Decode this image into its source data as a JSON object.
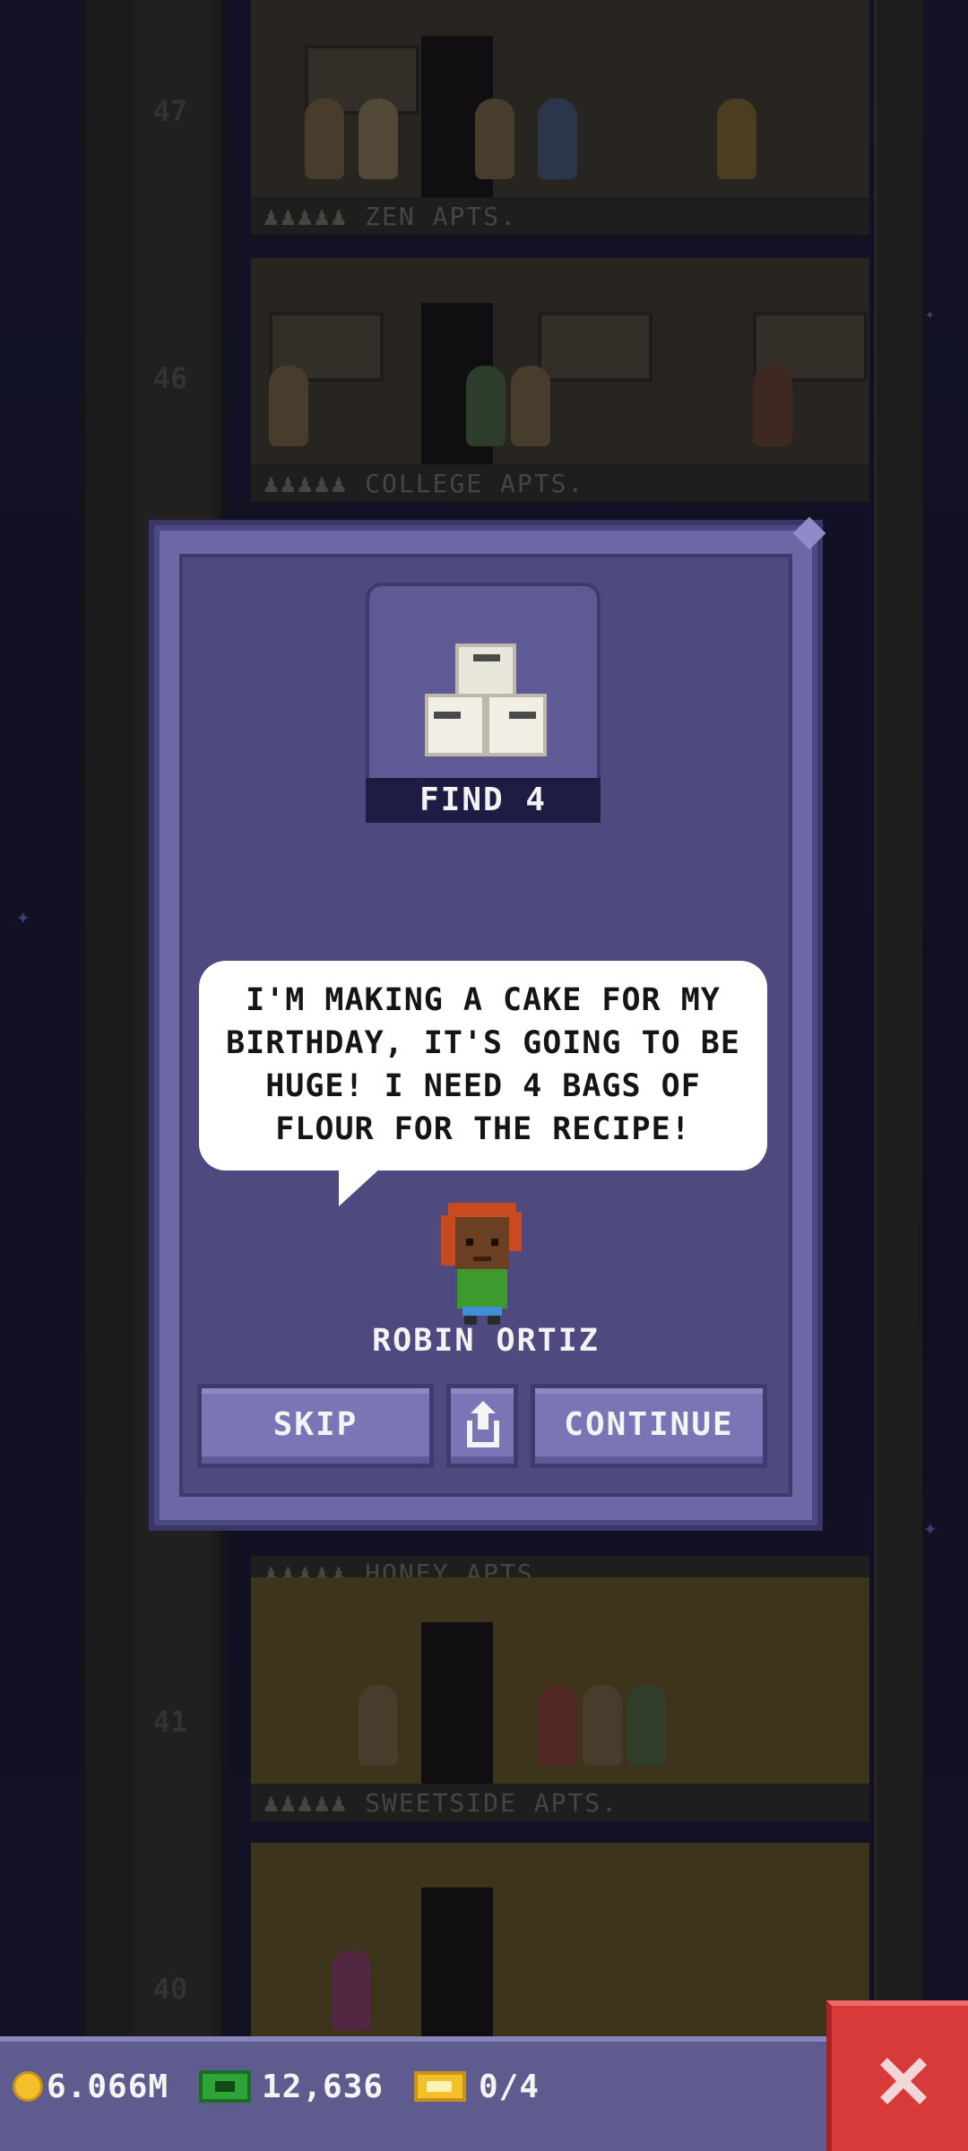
{
  "background": {
    "floors": [
      {
        "number": "47",
        "name": "ZEN APTS."
      },
      {
        "number": "46",
        "name": "COLLEGE APTS."
      },
      {
        "number": "41",
        "name": "HONEY APTS."
      },
      {
        "number": "40",
        "name": "SWEETSIDE APTS."
      }
    ]
  },
  "mission": {
    "item_icon": "flour-bags-icon",
    "find_label": "FIND 4",
    "message": "I'M MAKING A CAKE FOR MY BIRTHDAY, IT'S GOING TO BE HUGE! I NEED 4 BAGS OF FLOUR FOR THE RECIPE!",
    "character_name": "ROBIN ORTIZ",
    "buttons": {
      "skip": "SKIP",
      "share_icon": "share-icon",
      "continue": "CONTINUE"
    }
  },
  "hud": {
    "coins": "6.066M",
    "bux": "12,636",
    "tickets": "0/4",
    "close_icon": "close-icon"
  },
  "colors": {
    "dialog": "#6c68a6",
    "dialog_inner": "#4e4a80",
    "button": "#7a76b6",
    "close": "#d83a3a",
    "coin": "#f3c02a",
    "cash": "#2ca43a"
  }
}
